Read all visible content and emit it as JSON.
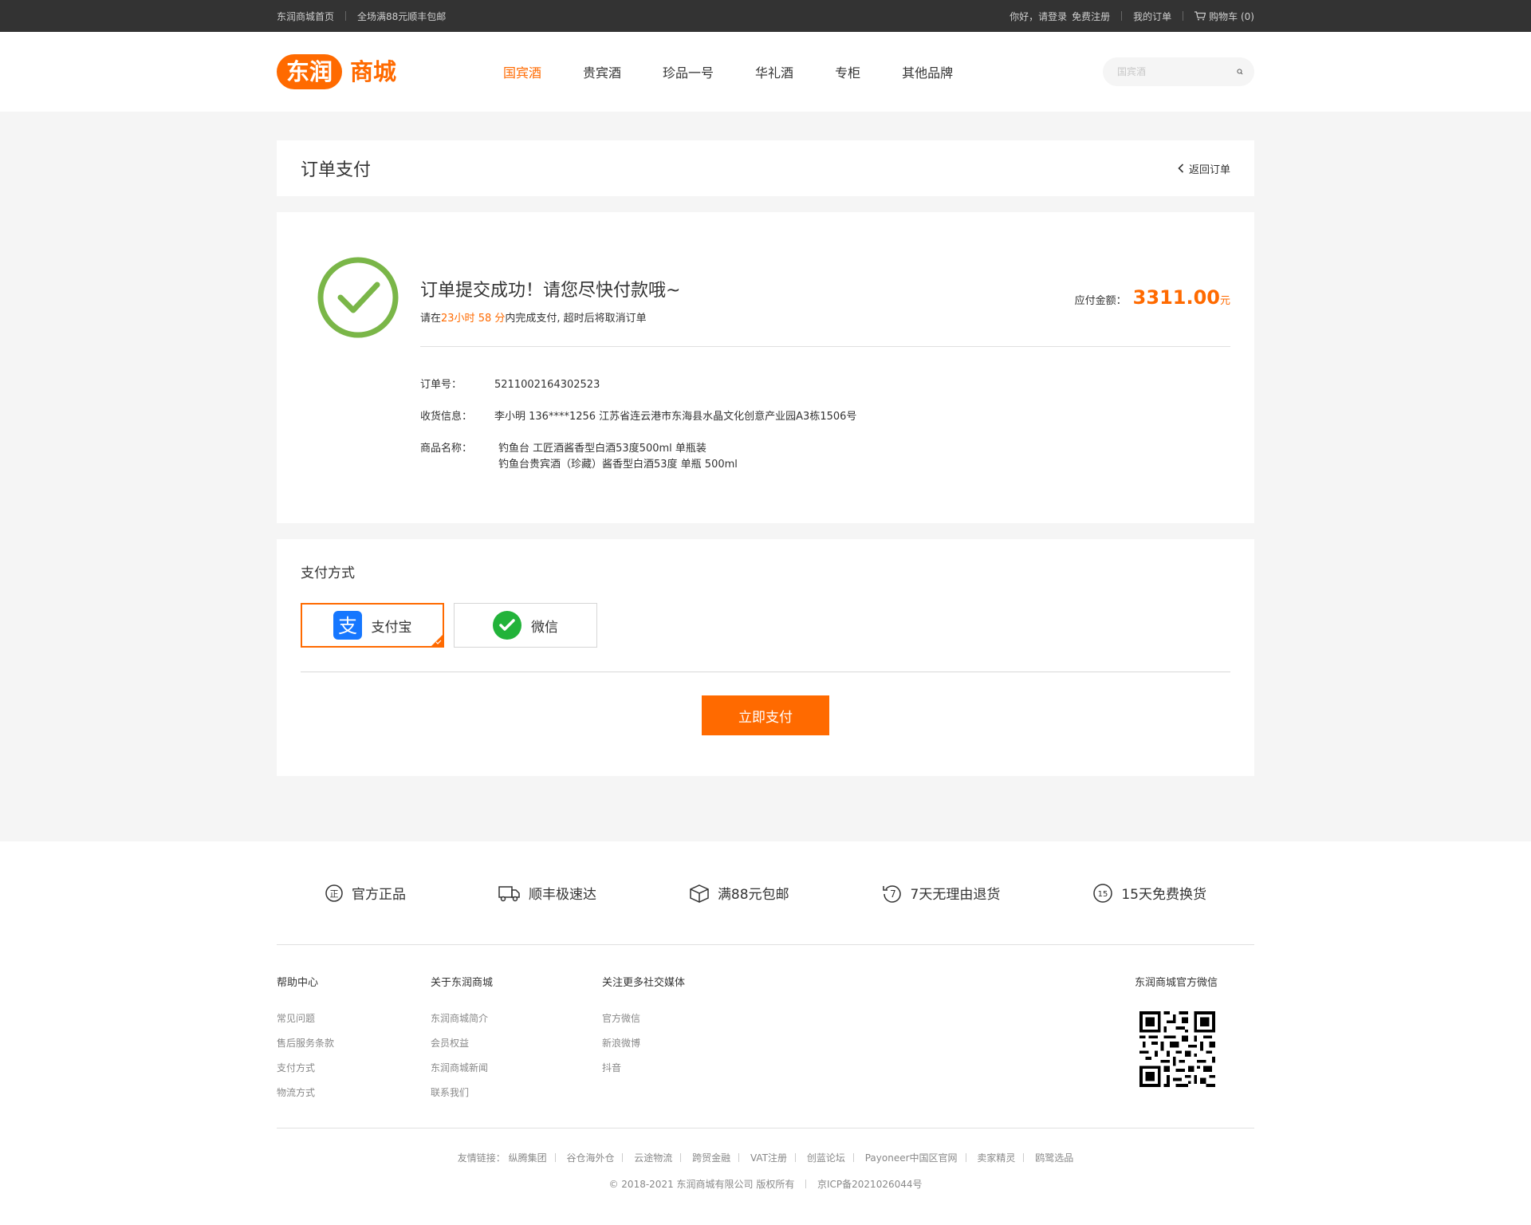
{
  "topbar": {
    "home": "东润商城首页",
    "free_shipping": "全场满88元顺丰包邮",
    "greeting": "你好，请登录",
    "register": "免费注册",
    "my_orders": "我的订单",
    "cart": "购物车 (0)"
  },
  "header": {
    "logo_text": "东润商城",
    "nav": [
      "国宾酒",
      "贵宾酒",
      "珍品一号",
      "华礼酒",
      "专柜",
      "其他品牌"
    ],
    "active_nav": "国宾酒",
    "search_placeholder": "国宾酒"
  },
  "page": {
    "title": "订单支付",
    "back_label": "返回订单"
  },
  "order": {
    "success_msg": "订单提交成功！请您尽快付款哦~",
    "countdown_prefix": "请在",
    "countdown": "23小时 58 分",
    "countdown_suffix": "内完成支付, 超时后将取消订单",
    "amount_label": "应付金额：",
    "amount": "3311.00",
    "amount_unit": "元",
    "number_label": "订单号：",
    "number": "5211002164302523",
    "address_label": "收货信息：",
    "address": "李小明 136****1256 江苏省连云港市东海县水晶文化创意产业园A3栋1506号",
    "goods_label": "商品名称：",
    "goods": [
      "钓鱼台 工匠酒酱香型白酒53度500ml 单瓶装",
      "钓鱼台贵宾酒（珍藏）酱香型白酒53度 单瓶 500ml"
    ]
  },
  "payment": {
    "title": "支付方式",
    "methods": [
      {
        "label": "支付宝",
        "icon": "alipay-icon",
        "selected": true
      },
      {
        "label": "微信",
        "icon": "wechat-icon",
        "selected": false
      }
    ],
    "pay_button": "立即支付"
  },
  "footer": {
    "guarantees": [
      {
        "label": "官方正品",
        "icon": "genuine-icon"
      },
      {
        "label": "顺丰极速达",
        "icon": "truck-icon"
      },
      {
        "label": "满88元包邮",
        "icon": "box-icon"
      },
      {
        "label": "7天无理由退货",
        "icon": "return-7-icon"
      },
      {
        "label": "15天免费换货",
        "icon": "exchange-15-icon"
      }
    ],
    "columns": [
      {
        "title": "帮助中心",
        "items": [
          "常见问题",
          "售后服务条款",
          "支付方式",
          "物流方式"
        ]
      },
      {
        "title": "关于东润商城",
        "items": [
          "东润商城简介",
          "会员权益",
          "东润商城新闻",
          "联系我们"
        ]
      },
      {
        "title": "关注更多社交媒体",
        "items": [
          "官方微信",
          "新浪微博",
          "抖音"
        ]
      }
    ],
    "wechat_title": "东润商城官方微信",
    "friends_label": "友情链接：",
    "friends": [
      "纵腾集团",
      "谷仓海外仓",
      "云途物流",
      "跨贸金融",
      "VAT注册",
      "创蓝论坛",
      "Payoneer中国区官网",
      "卖家精灵",
      "鸥鹭选品"
    ],
    "copyright": "© 2018-2021 东润商城有限公司 版权所有",
    "icp": "京ICP备2021026044号"
  },
  "colors": {
    "accent": "#ff6a00",
    "success": "#7ab648",
    "topbar": "#333333",
    "page_bg": "#f5f5f5"
  }
}
